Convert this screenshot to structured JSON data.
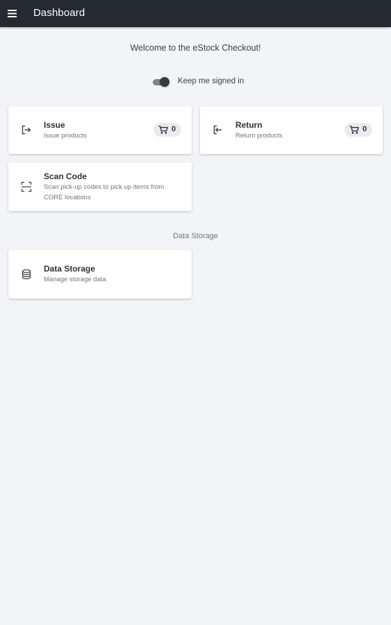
{
  "appbar": {
    "title": "Dashboard",
    "menu_icon": "menu-icon"
  },
  "welcome_text": "Welcome to the eStock Checkout!",
  "keep_signed_in": {
    "label": "Keep me signed in",
    "enabled": true
  },
  "cards": {
    "issue": {
      "title": "Issue",
      "subtitle": "Issue products",
      "icon": "issue-icon",
      "cart_count": "0"
    },
    "return": {
      "title": "Return",
      "subtitle": "Return products",
      "icon": "return-icon",
      "cart_count": "0"
    },
    "scan_code": {
      "title": "Scan Code",
      "subtitle": "Scan pick-up codes to pick up items from CORE locations",
      "icon": "scan-icon"
    }
  },
  "data_storage_section": {
    "label": "Data Storage",
    "card": {
      "title": "Data Storage",
      "subtitle": "Manage storage data",
      "icon": "database-icon"
    }
  },
  "colors": {
    "appbar": "#252a31",
    "background": "#f2f4f7",
    "card": "#ffffff",
    "chip": "#e9ebee"
  }
}
